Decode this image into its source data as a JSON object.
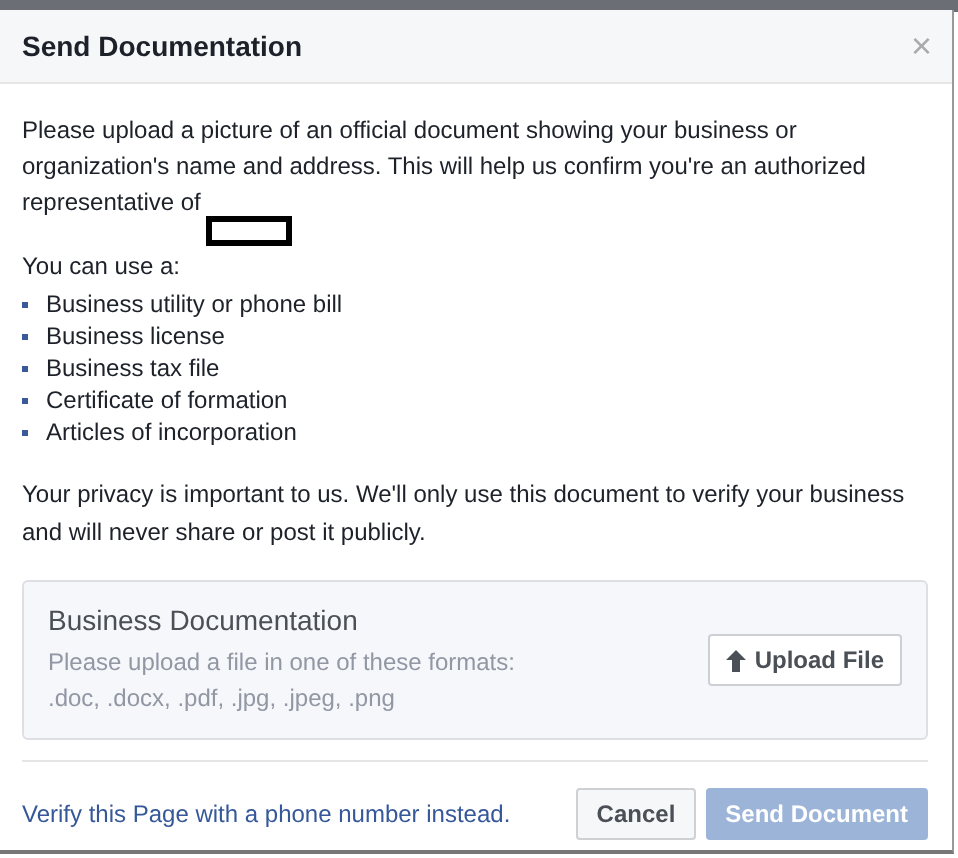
{
  "dialog": {
    "title": "Send Documentation",
    "close": "×"
  },
  "intro": "Please upload a picture of an official document showing your business or organization's name and address. This will help us confirm you're an authorized representative of",
  "list_heading": "You can use a:",
  "options": [
    "Business utility or phone bill",
    "Business license",
    "Business tax file",
    "Certificate of formation",
    "Articles of incorporation"
  ],
  "privacy": "Your privacy is important to us. We'll only use this document to verify your business and will never share or post it publicly.",
  "upload": {
    "title": "Business Documentation",
    "hint": "Please upload a file in one of these formats:",
    "formats": ".doc, .docx, .pdf, .jpg, .jpeg, .png",
    "button": "Upload File"
  },
  "footer": {
    "link": "Verify this Page with a phone number instead.",
    "buttons": [
      {
        "label": "Cancel",
        "kind": "secondary",
        "disabled": false
      },
      {
        "label": "Send Document",
        "kind": "primary",
        "disabled": true
      }
    ]
  }
}
